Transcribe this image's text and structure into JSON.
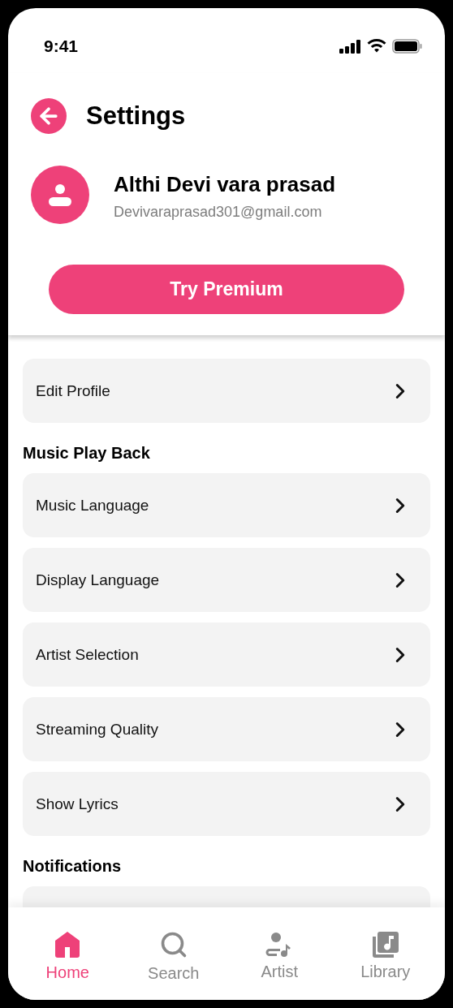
{
  "status_bar": {
    "time": "9:41"
  },
  "header": {
    "title": "Settings"
  },
  "profile": {
    "name": "Althi Devi vara prasad",
    "email": "Devivaraprasad301@gmail.com"
  },
  "premium_button": {
    "label": "Try Premium"
  },
  "list": [
    {
      "kind": "row",
      "label": "Edit Profile"
    },
    {
      "kind": "heading",
      "label": "Music Play Back"
    },
    {
      "kind": "row",
      "label": "Music Language"
    },
    {
      "kind": "row",
      "label": "Display Language"
    },
    {
      "kind": "row",
      "label": "Artist Selection"
    },
    {
      "kind": "row",
      "label": "Streaming Quality"
    },
    {
      "kind": "row",
      "label": "Show Lyrics"
    },
    {
      "kind": "heading",
      "label": "Notifications"
    },
    {
      "kind": "row"
    }
  ],
  "bottom_nav": [
    {
      "label": "Home",
      "selected": true
    },
    {
      "label": "Search",
      "selected": false
    },
    {
      "label": "Artist",
      "selected": false
    },
    {
      "label": "Library",
      "selected": false
    }
  ]
}
